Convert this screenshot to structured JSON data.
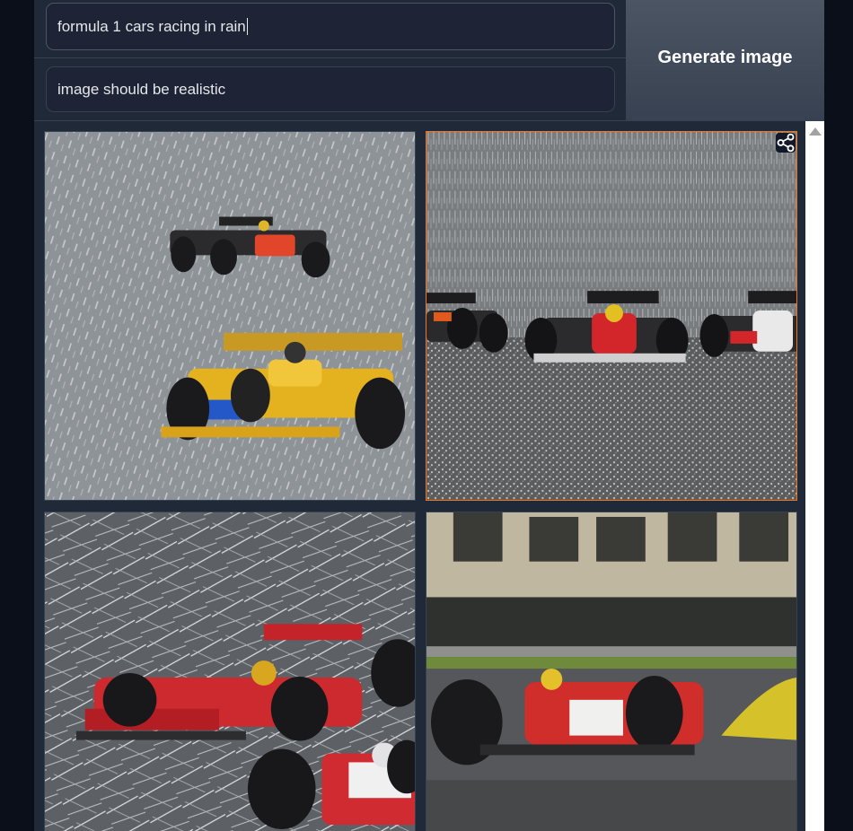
{
  "prompt": {
    "main_value": "formula 1 cars racing in rain",
    "negative_value": "image should be realistic"
  },
  "actions": {
    "generate_label": "Generate image"
  },
  "gallery": {
    "images": [
      {
        "subject": "two F1 cars in heavy rain, grey background, yellow car foreground",
        "selected": false
      },
      {
        "subject": "three F1 cars on grid in heavy downpour",
        "selected": true
      },
      {
        "subject": "red F1 cars with sketched rain streaks",
        "selected": false
      },
      {
        "subject": "red and white F1 car on wet track with crowd",
        "selected": false
      }
    ],
    "share_icon": "share-icon"
  },
  "colors": {
    "accent_selected": "#f97316",
    "panel": "#1f2937",
    "button": "#4b5563"
  }
}
